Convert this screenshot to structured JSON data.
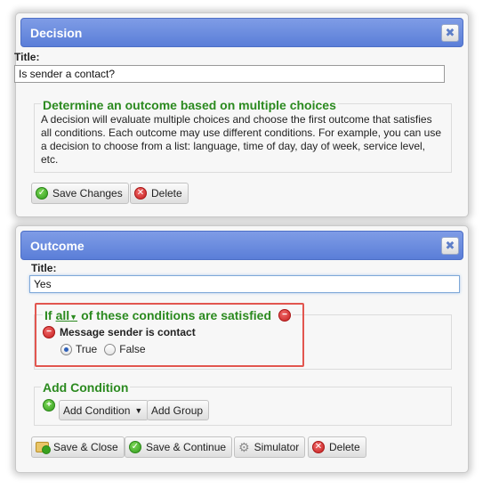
{
  "decision_dialog": {
    "title": "Decision",
    "close_glyph": "✖",
    "title_label": "Title:",
    "title_value": "Is sender a contact?",
    "section_legend": "Determine an outcome based on multiple choices",
    "description": "A decision will evaluate multiple choices and choose the first outcome that satisfies all conditions. Each outcome may use different conditions. For example, you can use a decision to choose from a list: language, time of day, day of week, service level, etc.",
    "save_button": "Save Changes",
    "delete_button": "Delete"
  },
  "outcome_dialog": {
    "title": "Outcome",
    "close_glyph": "✖",
    "title_label": "Title:",
    "title_value": "Yes",
    "conditions_prefix": "If",
    "conditions_mode": "all",
    "conditions_suffix": "of these conditions are satisfied",
    "condition": {
      "label": "Message sender is contact",
      "options": [
        "True",
        "False"
      ],
      "selected": "True"
    },
    "add_condition_legend": "Add Condition",
    "add_condition_button": "Add Condition",
    "add_group_button": "Add Group",
    "buttons": {
      "save_close": "Save & Close",
      "save_continue": "Save & Continue",
      "simulator": "Simulator",
      "delete": "Delete"
    }
  },
  "icons": {
    "close": "close-icon",
    "check": "check-circle-icon",
    "delete": "delete-circle-icon",
    "remove": "minus-circle-icon",
    "add": "plus-circle-icon",
    "folder": "folder-save-icon",
    "gear": "gear-icon",
    "caret": "chevron-down-icon"
  },
  "colors": {
    "titlebar": "#5a7ed8",
    "legend_green": "#2b8a1f",
    "highlight_red": "#e2564f"
  }
}
